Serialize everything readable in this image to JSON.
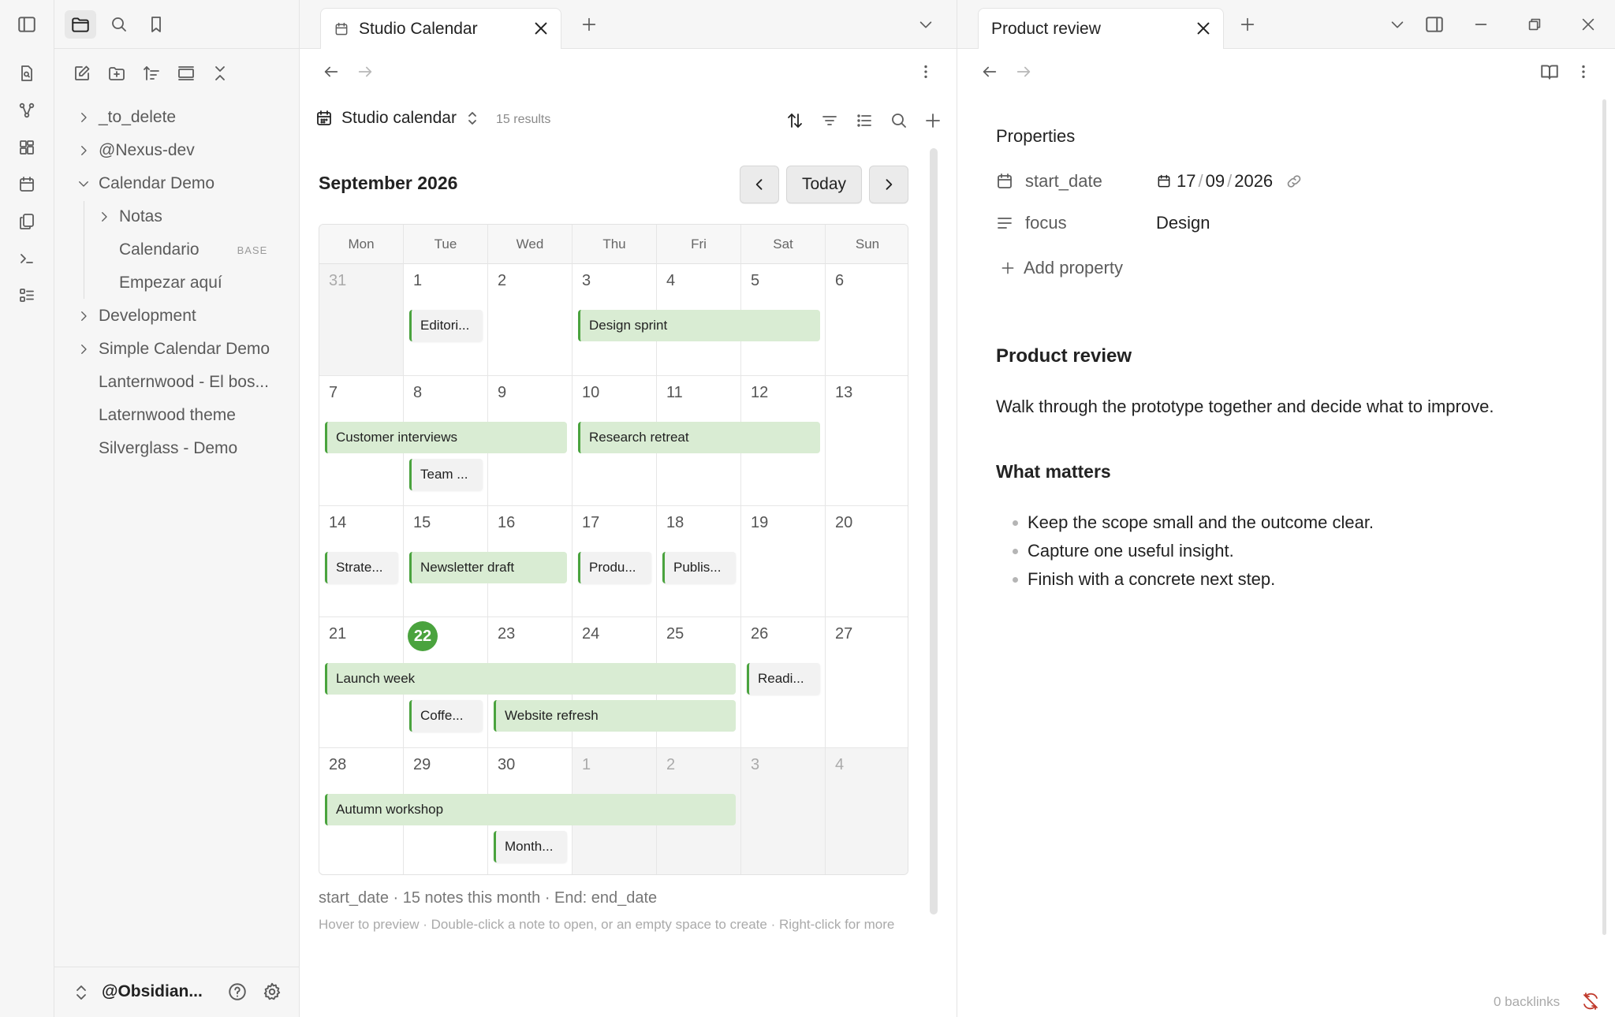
{
  "sidebar": {
    "tree": [
      {
        "label": "_to_delete",
        "type": "folder-collapsed"
      },
      {
        "label": "@Nexus-dev",
        "type": "folder-collapsed"
      },
      {
        "label": "Calendar Demo",
        "type": "folder-expanded"
      },
      {
        "label": "Notas",
        "type": "folder-collapsed"
      },
      {
        "label": "Calendario",
        "badge": "BASE",
        "type": "file"
      },
      {
        "label": "Empezar aquí",
        "type": "file"
      },
      {
        "label": "Development",
        "type": "folder-collapsed"
      },
      {
        "label": "Simple Calendar Demo",
        "type": "folder-collapsed"
      },
      {
        "label": "Lanternwood - El bos...",
        "type": "file"
      },
      {
        "label": "Laternwood theme",
        "type": "file"
      },
      {
        "label": "Silverglass - Demo",
        "type": "file"
      }
    ],
    "vault_name": "@Obsidian..."
  },
  "left_pane": {
    "tab_title": "Studio Calendar",
    "view_name": "Studio calendar",
    "results": "15 results",
    "month_title": "September 2026",
    "today_label": "Today",
    "weekdays": [
      "Mon",
      "Tue",
      "Wed",
      "Thu",
      "Fri",
      "Sat",
      "Sun"
    ],
    "weeks": [
      [
        {
          "d": "31",
          "out": true
        },
        {
          "d": "1"
        },
        {
          "d": "2"
        },
        {
          "d": "3"
        },
        {
          "d": "4"
        },
        {
          "d": "5"
        },
        {
          "d": "6"
        }
      ],
      [
        {
          "d": "7"
        },
        {
          "d": "8"
        },
        {
          "d": "9"
        },
        {
          "d": "10"
        },
        {
          "d": "11"
        },
        {
          "d": "12"
        },
        {
          "d": "13"
        }
      ],
      [
        {
          "d": "14"
        },
        {
          "d": "15"
        },
        {
          "d": "16"
        },
        {
          "d": "17"
        },
        {
          "d": "18"
        },
        {
          "d": "19"
        },
        {
          "d": "20"
        }
      ],
      [
        {
          "d": "21"
        },
        {
          "d": "22",
          "today": true
        },
        {
          "d": "23"
        },
        {
          "d": "24"
        },
        {
          "d": "25"
        },
        {
          "d": "26"
        },
        {
          "d": "27"
        }
      ],
      [
        {
          "d": "28"
        },
        {
          "d": "29"
        },
        {
          "d": "30"
        },
        {
          "d": "1",
          "out": true
        },
        {
          "d": "2",
          "out": true
        },
        {
          "d": "3",
          "out": true
        },
        {
          "d": "4",
          "out": true
        }
      ]
    ],
    "events": [
      {
        "title": "Editori...",
        "week": 0,
        "start": 1,
        "span": 1,
        "lane": 0,
        "kind": "single"
      },
      {
        "title": "Design sprint",
        "week": 0,
        "start": 3,
        "span": 3,
        "lane": 0,
        "kind": "span"
      },
      {
        "title": "Customer interviews",
        "week": 1,
        "start": 0,
        "span": 3,
        "lane": 0,
        "kind": "span"
      },
      {
        "title": "Research retreat",
        "week": 1,
        "start": 3,
        "span": 3,
        "lane": 0,
        "kind": "span"
      },
      {
        "title": "Team ...",
        "week": 1,
        "start": 1,
        "span": 1,
        "lane": 1,
        "kind": "single"
      },
      {
        "title": "Strate...",
        "week": 2,
        "start": 0,
        "span": 1,
        "lane": 0,
        "kind": "single"
      },
      {
        "title": "Newsletter draft",
        "week": 2,
        "start": 1,
        "span": 2,
        "lane": 0,
        "kind": "span"
      },
      {
        "title": "Produ...",
        "week": 2,
        "start": 3,
        "span": 1,
        "lane": 0,
        "kind": "single"
      },
      {
        "title": "Publis...",
        "week": 2,
        "start": 4,
        "span": 1,
        "lane": 0,
        "kind": "single"
      },
      {
        "title": "Launch week",
        "week": 3,
        "start": 0,
        "span": 5,
        "lane": 0,
        "kind": "span"
      },
      {
        "title": "Readi...",
        "week": 3,
        "start": 5,
        "span": 1,
        "lane": 0,
        "kind": "single"
      },
      {
        "title": "Coffe...",
        "week": 3,
        "start": 1,
        "span": 1,
        "lane": 1,
        "kind": "single"
      },
      {
        "title": "Website refresh",
        "week": 3,
        "start": 2,
        "span": 3,
        "lane": 1,
        "kind": "span"
      },
      {
        "title": "Autumn workshop",
        "week": 4,
        "start": 0,
        "span": 5,
        "lane": 0,
        "kind": "span"
      },
      {
        "title": "Month...",
        "week": 4,
        "start": 2,
        "span": 1,
        "lane": 1,
        "kind": "single"
      }
    ],
    "footer_info": "start_date · 15 notes this month · End: end_date",
    "footer_hint": "Hover to preview · Double-click a note to open, or an empty space to create · Right-click for more"
  },
  "right_pane": {
    "tab_title": "Product review",
    "properties_heading": "Properties",
    "props": [
      {
        "key": "start_date",
        "value_day": "17",
        "value_month": "09",
        "value_year": "2026"
      },
      {
        "key": "focus",
        "value": "Design"
      }
    ],
    "add_property": "Add property",
    "note_title": "Product review",
    "intro": "Walk through the prototype together and decide what to improve.",
    "section_heading": "What matters",
    "bullets": [
      "Keep the scope small and the outcome clear.",
      "Capture one useful insight.",
      "Finish with a concrete next step."
    ],
    "backlinks": "0 backlinks"
  },
  "colors": {
    "accent_green": "#4aa33e",
    "event_bg": "#d9ecd3"
  }
}
